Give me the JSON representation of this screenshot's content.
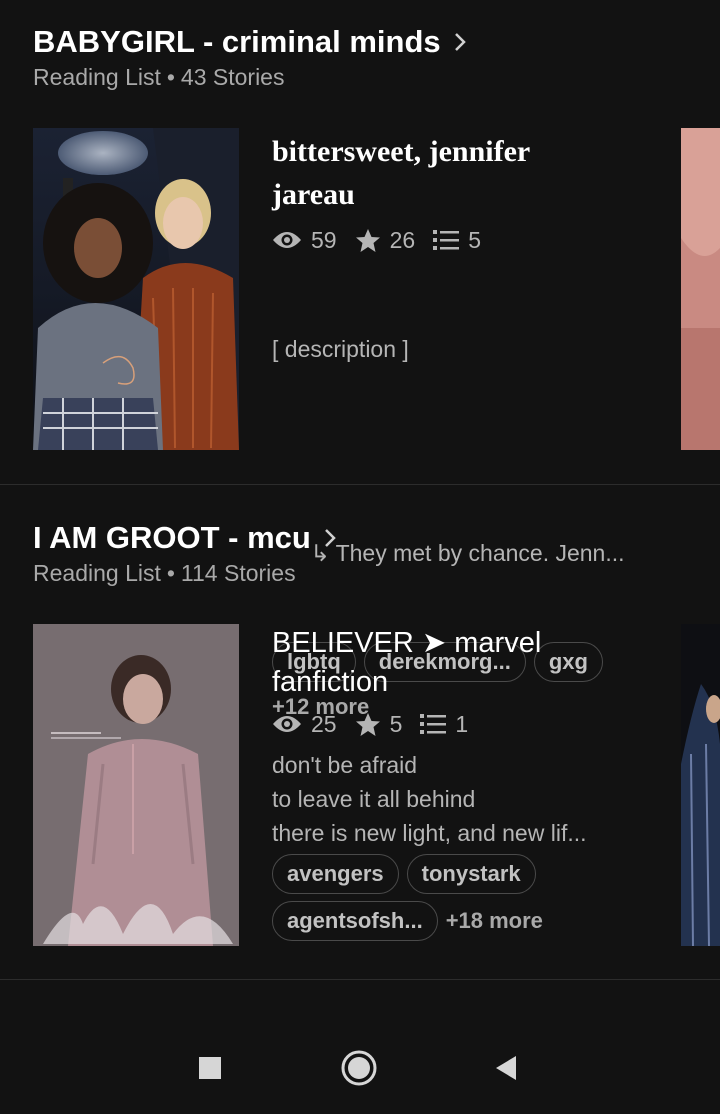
{
  "lists": [
    {
      "title": "BABYGIRL - criminal minds",
      "type_label": "Reading List",
      "separator": "•",
      "count_label": "43 Stories",
      "story": {
        "title": "bittersweet, jennifer jareau",
        "views": "59",
        "votes": "26",
        "parts": "5",
        "description_lines": [
          "[ description ]",
          "",
          "      ↳ They met by chance. Jenn..."
        ],
        "tags": [
          "lgbtq",
          "derekmorg...",
          "gxg"
        ],
        "more": "+12 more"
      }
    },
    {
      "title": "I AM GROOT - mcu",
      "type_label": "Reading List",
      "separator": "•",
      "count_label": "114 Stories",
      "story": {
        "title": "BELIEVER ➤ marvel fanfiction",
        "views": "25",
        "votes": "5",
        "parts": "1",
        "description_lines": [
          "don't be afraid",
          "to leave it all behind",
          "there is new light, and new lif..."
        ],
        "tags": [
          "avengers",
          "tonystark",
          "agentsofsh..."
        ],
        "more": "+18 more"
      }
    }
  ],
  "icons": {
    "chevron": "chevron-right-icon",
    "views": "eye-icon",
    "votes": "star-icon",
    "parts": "list-icon",
    "nav_recents": "square-icon",
    "nav_home": "circle-icon",
    "nav_back": "triangle-back-icon"
  },
  "colors": {
    "background": "#121212",
    "muted_text": "#a9a9a9",
    "tag_border": "#4a4a4a"
  }
}
